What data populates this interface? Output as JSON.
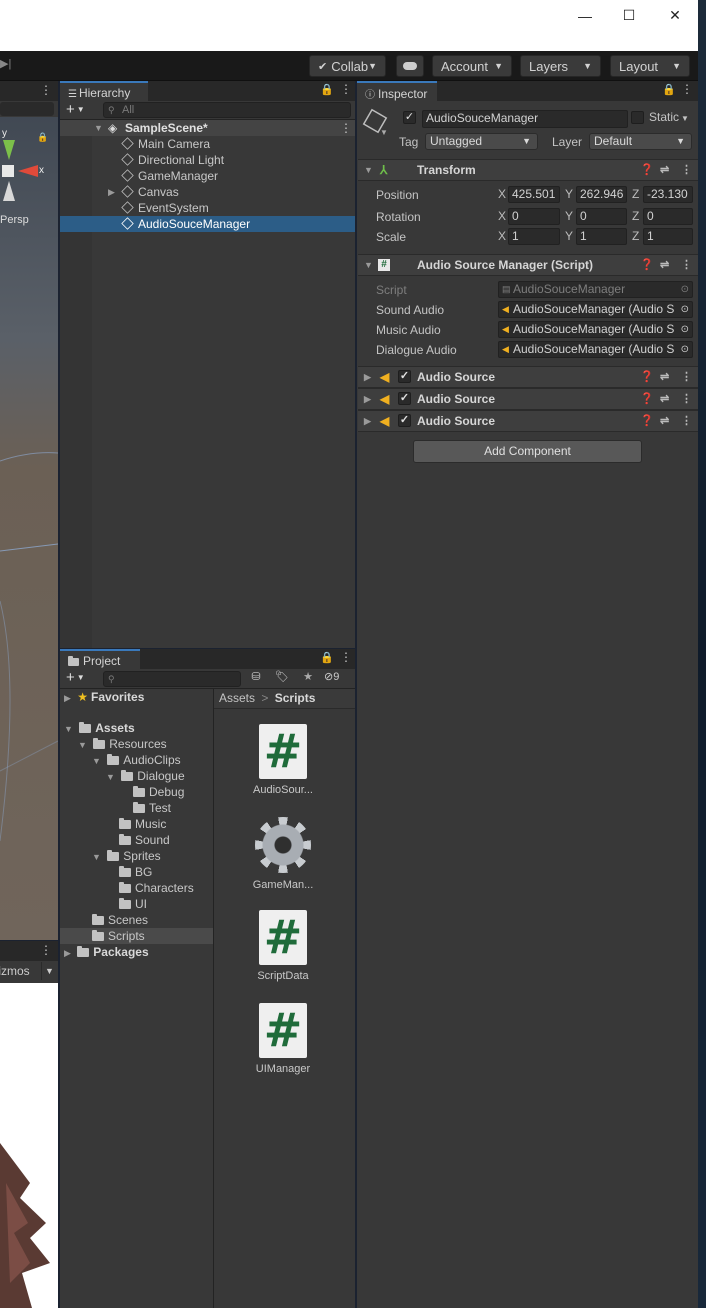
{
  "window": {
    "minimize_glyph": "—",
    "maximize_glyph": "☐",
    "close_glyph": "✕"
  },
  "toolbar": {
    "collab_label": "Collab",
    "account_label": "Account",
    "layers_label": "Layers",
    "layout_label": "Layout"
  },
  "scene": {
    "persp_label": "Persp",
    "axis_x": "x",
    "axis_y": "y",
    "gizmos_label": "Gizmos"
  },
  "hierarchy": {
    "tab_label": "Hierarchy",
    "search_placeholder": "All",
    "scene_name": "SampleScene*",
    "items": [
      {
        "label": "Main Camera"
      },
      {
        "label": "Directional Light"
      },
      {
        "label": "GameManager"
      },
      {
        "label": "Canvas"
      },
      {
        "label": "EventSystem"
      },
      {
        "label": "AudioSouceManager"
      }
    ]
  },
  "inspector": {
    "tab_label": "Inspector",
    "object_name": "AudioSouceManager",
    "static_label": "Static",
    "tag_label": "Tag",
    "tag_value": "Untagged",
    "layer_label": "Layer",
    "layer_value": "Default",
    "transform": {
      "title": "Transform",
      "position_label": "Position",
      "rotation_label": "Rotation",
      "scale_label": "Scale",
      "axis_x": "X",
      "axis_y": "Y",
      "axis_z": "Z",
      "position": {
        "x": "425.501",
        "y": "262.946",
        "z": "-23.130"
      },
      "rotation": {
        "x": "0",
        "y": "0",
        "z": "0"
      },
      "scale": {
        "x": "1",
        "y": "1",
        "z": "1"
      }
    },
    "script_component": {
      "title": "Audio Source Manager (Script)",
      "script_label": "Script",
      "script_value": "AudioSouceManager",
      "sound_label": "Sound Audio",
      "sound_value": "AudioSouceManager (Audio S",
      "music_label": "Music Audio",
      "music_value": "AudioSouceManager (Audio S",
      "dialogue_label": "Dialogue Audio",
      "dialogue_value": "AudioSouceManager (Audio S"
    },
    "audio_sources": [
      {
        "title": "Audio Source"
      },
      {
        "title": "Audio Source"
      },
      {
        "title": "Audio Source"
      }
    ],
    "add_component_label": "Add Component"
  },
  "project": {
    "tab_label": "Project",
    "hidden_count": "9",
    "breadcrumb_root": "Assets",
    "breadcrumb_sep": ">",
    "breadcrumb_current": "Scripts",
    "favorites_label": "Favorites",
    "tree": {
      "assets": "Assets",
      "resources": "Resources",
      "audioclips": "AudioClips",
      "dialogue": "Dialogue",
      "debug": "Debug",
      "test": "Test",
      "music": "Music",
      "sound": "Sound",
      "sprites": "Sprites",
      "bg": "BG",
      "characters": "Characters",
      "ui": "UI",
      "scenes": "Scenes",
      "scripts": "Scripts",
      "packages": "Packages"
    },
    "assets_grid": [
      {
        "label": "AudioSour..."
      },
      {
        "label": "GameMan..."
      },
      {
        "label": "ScriptData"
      },
      {
        "label": "UIManager"
      }
    ]
  },
  "colors": {
    "selection": "#2c5d87",
    "panel": "#383838",
    "script_hash": "#1f6b3a"
  }
}
